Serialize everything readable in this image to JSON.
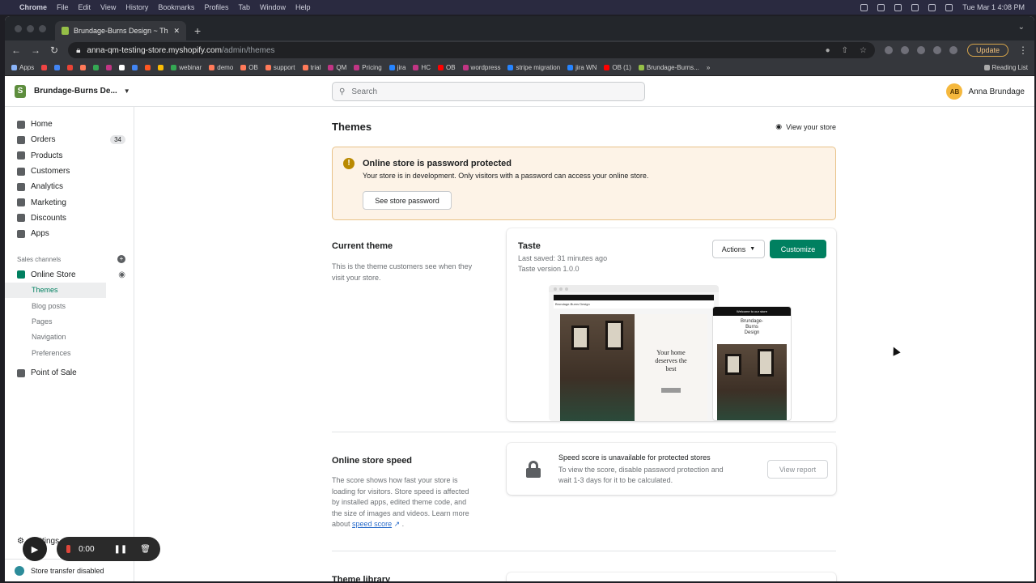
{
  "mac_menu": {
    "app": "Chrome",
    "items": [
      "File",
      "Edit",
      "View",
      "History",
      "Bookmarks",
      "Profiles",
      "Tab",
      "Window",
      "Help"
    ],
    "datetime": "Tue Mar 1  4:08 PM"
  },
  "browser": {
    "tab_title": "Brundage-Burns Design ~ Them",
    "url_host": "anna-qm-testing-store.myshopify.com",
    "url_path": "/admin/themes",
    "update_label": "Update",
    "bookmarks": [
      "Apps",
      "webinar",
      "demo",
      "OB",
      "support",
      "trial",
      "QM",
      "Pricing",
      "jira",
      "HC",
      "OB",
      "wordpress",
      "stripe migration",
      "jira WN",
      "OB (1)",
      "Brundage-Burns..."
    ],
    "reading_list": "Reading List"
  },
  "header": {
    "store_name": "Brundage-Burns De...",
    "search_placeholder": "Search",
    "user_initials": "AB",
    "user_name": "Anna Brundage"
  },
  "sidebar": {
    "items": [
      {
        "label": "Home"
      },
      {
        "label": "Orders",
        "badge": "34"
      },
      {
        "label": "Products"
      },
      {
        "label": "Customers"
      },
      {
        "label": "Analytics"
      },
      {
        "label": "Marketing"
      },
      {
        "label": "Discounts"
      },
      {
        "label": "Apps"
      }
    ],
    "sales_channels_label": "Sales channels",
    "online_store": "Online Store",
    "sub_items": [
      "Themes",
      "Blog posts",
      "Pages",
      "Navigation",
      "Preferences"
    ],
    "point_of_sale": "Point of Sale",
    "settings": "Settings",
    "store_transfer": "Store transfer disabled"
  },
  "main": {
    "title": "Themes",
    "view_store": "View your store",
    "banner": {
      "title": "Online store is password protected",
      "body": "Your store is in development. Only visitors with a password can access your online store.",
      "button": "See store password"
    },
    "current_theme": {
      "heading": "Current theme",
      "desc_line1": "This is the theme customers see when they",
      "desc_line2": "visit your store.",
      "theme_name": "Taste",
      "last_saved": "Last saved: 31 minutes ago",
      "version": "Taste version 1.0.0",
      "actions": "Actions",
      "customize": "Customize",
      "preview_store": "Brundage-Burns Design",
      "preview_welcome": "Welcome to our store",
      "preview_headline_1": "Your home",
      "preview_headline_2": "deserves the",
      "preview_headline_3": "best",
      "mobile_store_1": "Brundage-",
      "mobile_store_2": "Burns",
      "mobile_store_3": "Design"
    },
    "speed": {
      "heading": "Online store speed",
      "desc_l1": "The score shows how fast your store is",
      "desc_l2": "loading for visitors. Store speed is affected",
      "desc_l3": "by installed apps, edited theme code, and",
      "desc_l4": "the size of images and videos. Learn more",
      "desc_about": "about",
      "desc_link": "speed score",
      "card_title": "Speed score is unavailable for protected stores",
      "card_l1": "To view the score, disable password protection and",
      "card_l2": "wait 1-3 days for it to be calculated.",
      "view_report": "View report"
    },
    "library_heading": "Theme library"
  },
  "recorder": {
    "time": "0:00"
  }
}
